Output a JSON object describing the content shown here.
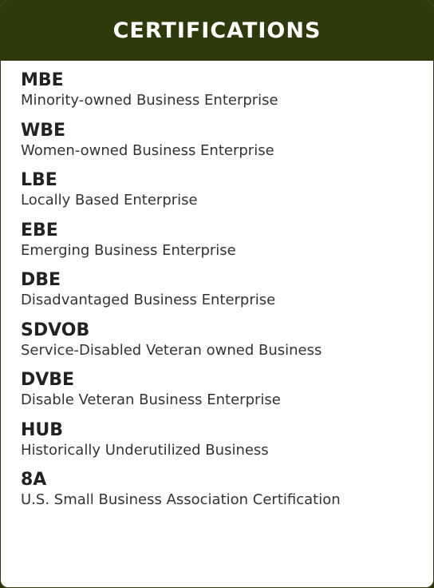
{
  "header": {
    "title": "CERTIFICATIONS"
  },
  "colors": {
    "header_bg": "#2f3a0b",
    "header_text": "#ffffff",
    "body_bg": "#ffffff",
    "text": "#222222"
  },
  "certifications": [
    {
      "abbr": "MBE",
      "desc": "Minority-owned Business Enterprise"
    },
    {
      "abbr": "WBE",
      "desc": "Women-owned Business Enterprise"
    },
    {
      "abbr": "LBE",
      "desc": "Locally Based Enterprise"
    },
    {
      "abbr": "EBE",
      "desc": "Emerging Business Enterprise"
    },
    {
      "abbr": "DBE",
      "desc": "Disadvantaged Business Enterprise"
    },
    {
      "abbr": "SDVOB",
      "desc": "Service-Disabled Veteran owned Business"
    },
    {
      "abbr": "DVBE",
      "desc": "Disable Veteran Business Enterprise"
    },
    {
      "abbr": "HUB",
      "desc": "Historically Underutilized Business"
    },
    {
      "abbr": "8A",
      "desc": "U.S. Small Business Association Certification"
    }
  ]
}
